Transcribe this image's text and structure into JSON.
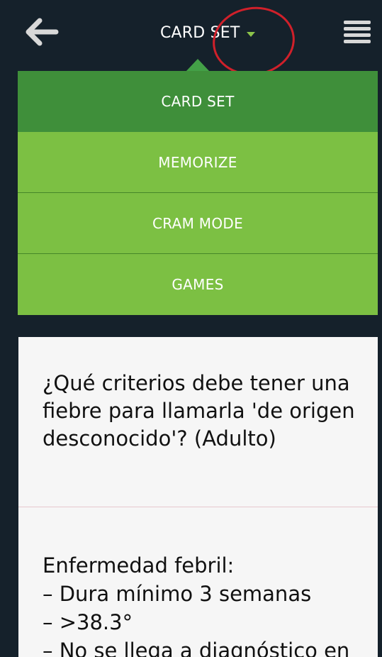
{
  "header": {
    "title": "CARD SET"
  },
  "colors": {
    "background": "#15212b",
    "menu_active": "#3f8f3a",
    "menu_item": "#7cc043",
    "accent_caret": "#8bc34a",
    "annotation": "#d0202a",
    "card_background": "#f6f6f6"
  },
  "icons": {
    "back": "back-arrow-icon",
    "menu": "hamburger-menu-icon",
    "dropdown": "chevron-down-icon"
  },
  "dropdown": {
    "items": [
      {
        "label": "CARD SET"
      },
      {
        "label": "MEMORIZE"
      },
      {
        "label": "CRAM MODE"
      },
      {
        "label": "GAMES"
      }
    ]
  },
  "card": {
    "question": "¿Qué criterios debe tener una fiebre para llamarla 'de origen desconocido'? (Adulto)",
    "answer_lines": [
      "Enfermedad febril:",
      "– Dura mínimo 3 semanas",
      "– >38.3°",
      "– No se llega a diagnóstico en"
    ]
  }
}
